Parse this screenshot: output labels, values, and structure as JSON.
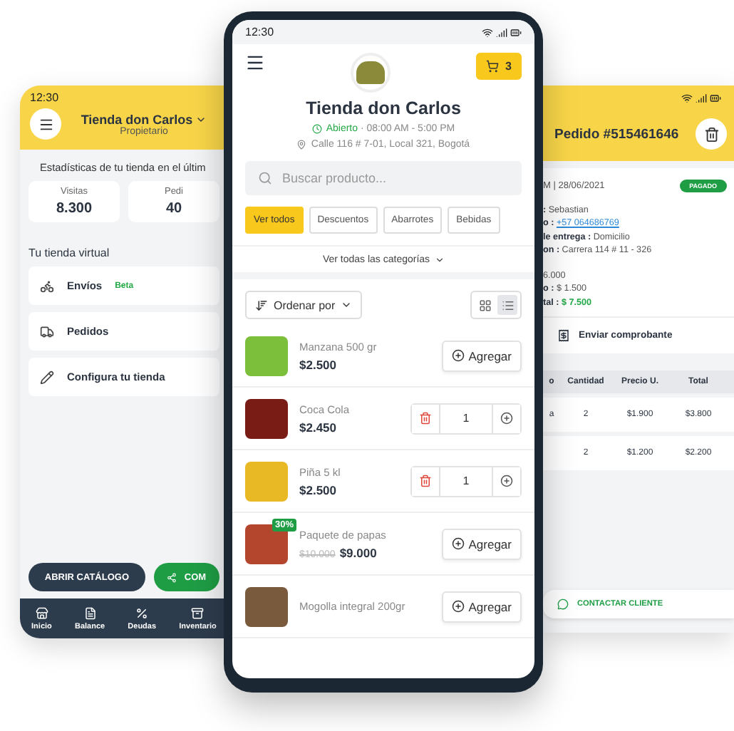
{
  "left_phone": {
    "time": "12:30",
    "store_name": "Tienda don Carlos",
    "role": "Propietario",
    "stats_title": "Estadísticas de tu tienda en el últim",
    "stats": [
      {
        "label": "Visitas",
        "value": "8.300"
      },
      {
        "label": "Pedi",
        "value": "40"
      }
    ],
    "section_title": "Tu tienda virtual",
    "menu": [
      {
        "kind": "bike",
        "label": "Envíos",
        "badge": "Beta"
      },
      {
        "kind": "truck",
        "label": "Pedidos"
      },
      {
        "kind": "pencil",
        "label": "Configura tu tienda"
      }
    ],
    "buttons": [
      {
        "kind": "dark",
        "label": "ABRIR CATÁLOGO"
      },
      {
        "kind": "share",
        "label": "COM"
      }
    ],
    "nav": [
      {
        "kind": "store",
        "label": "Inicio"
      },
      {
        "kind": "doc",
        "label": "Balance"
      },
      {
        "kind": "percent",
        "label": "Deudas"
      },
      {
        "kind": "box",
        "label": "Inventario"
      }
    ]
  },
  "center_phone": {
    "time": "12:30",
    "cart_count": "3",
    "store_name": "Tienda don Carlos",
    "status": "Abierto",
    "hours": "· 08:00 AM - 5:00 PM",
    "address": "Calle 116 # 7-01, Local 321, Bogotá",
    "search": {
      "placeholder": "Buscar producto..."
    },
    "categories": [
      {
        "label": "Ver todos",
        "selected": true
      },
      {
        "label": "Descuentos",
        "selected": false
      },
      {
        "label": "Abarrotes",
        "selected": false
      },
      {
        "label": "Bebidas",
        "selected": false
      }
    ],
    "all_categories": "Ver todas las categorías",
    "sort_label": "Ordenar por",
    "views": [
      {
        "kind": "grid",
        "selected": false
      },
      {
        "kind": "list",
        "selected": true
      }
    ],
    "products": [
      {
        "name": "Manzana 500 gr",
        "price": "$2.500",
        "kind": "add",
        "action": "Agregar",
        "color": "#7cbf3a"
      },
      {
        "name": "Coca Cola",
        "price": "$2.450",
        "kind": "qty",
        "quantity": "1",
        "color": "#7a1c16"
      },
      {
        "name": "Piña 5 kl",
        "price": "$2.500",
        "kind": "qty",
        "quantity": "1",
        "color": "#e8b925"
      },
      {
        "name": "Paquete de papas",
        "old_price": "$10.000",
        "price": "$9.000",
        "discount": "30%",
        "kind": "add",
        "action": "Agregar",
        "color": "#b5462e"
      },
      {
        "name": "Mogolla integral 200gr",
        "kind": "add",
        "action": "Agregar",
        "color": "#7a5a3c"
      }
    ]
  },
  "right_phone": {
    "title": "Pedido #515461646",
    "date": "M | 28/06/2021",
    "badge": "PAGADO",
    "details": [
      {
        "label": ":",
        "value": "Sebastian",
        "kind": "text"
      },
      {
        "label": "o :",
        "value": "+57 064686769",
        "kind": "link"
      },
      {
        "label": "le entrega :",
        "value": "Domicilio",
        "kind": "text"
      },
      {
        "label": "on :",
        "value": "Carrera 114 # 11 - 326",
        "kind": "text"
      },
      {
        "value": "6.000",
        "kind": "gap"
      },
      {
        "label": "o :",
        "value": "$ 1.500",
        "kind": "text"
      },
      {
        "label": "tal :",
        "value": "$ 7.500",
        "kind": "total"
      }
    ],
    "receipt": "Enviar comprobante",
    "columns": [
      "o",
      "Cantidad",
      "Precio U.",
      "Total"
    ],
    "rows": [
      [
        "a",
        "2",
        "$1.900",
        "$3.800"
      ],
      [
        "",
        "2",
        "$1.200",
        "$2.200"
      ]
    ],
    "contact": "CONTACTAR CLIENTE"
  }
}
